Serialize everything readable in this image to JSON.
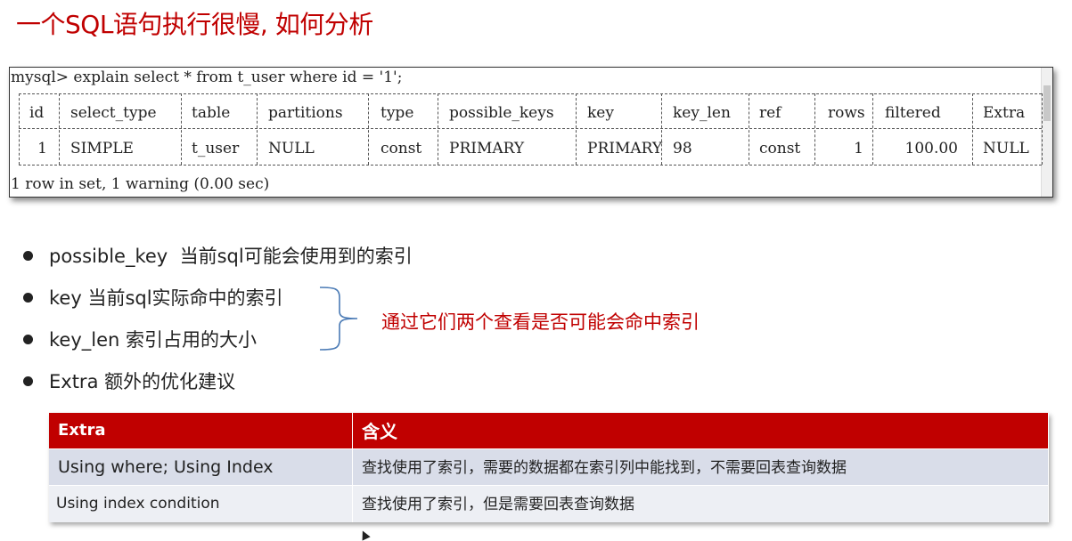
{
  "title": "一个SQL语句执行很慢, 如何分析",
  "terminal": {
    "command": "mysql> explain select * from t_user where id = '1';",
    "headers": [
      "id",
      "select_type",
      "table",
      "partitions",
      "type",
      "possible_keys",
      "key",
      "key_len",
      "ref",
      "rows",
      "filtered",
      "Extra"
    ],
    "row": [
      "1",
      "SIMPLE",
      "t_user",
      "NULL",
      "const",
      "PRIMARY",
      "PRIMARY",
      "98",
      "const",
      "1",
      "100.00",
      "NULL"
    ],
    "footer": "1 row in set, 1 warning (0.00 sec)"
  },
  "bullets": [
    {
      "term": "possible_key",
      "desc": "当前sql可能会使用到的索引"
    },
    {
      "term": "key",
      "desc": "当前sql实际命中的索引"
    },
    {
      "term": "key_len",
      "desc": "索引占用的大小"
    },
    {
      "term": "Extra",
      "desc": "额外的优化建议"
    }
  ],
  "annotation": "通过它们两个查看是否可能会命中索引",
  "extra_table": {
    "headers": [
      "Extra",
      "含义"
    ],
    "rows": [
      [
        "Using where; Using Index",
        "查找使用了索引，需要的数据都在索引列中能找到，不需要回表查询数据"
      ],
      [
        "Using index condition",
        "查找使用了索引，但是需要回表查询数据"
      ]
    ]
  },
  "colors": {
    "accent": "#c00000",
    "row_odd": "#d9dde9",
    "row_even": "#edeff4"
  }
}
